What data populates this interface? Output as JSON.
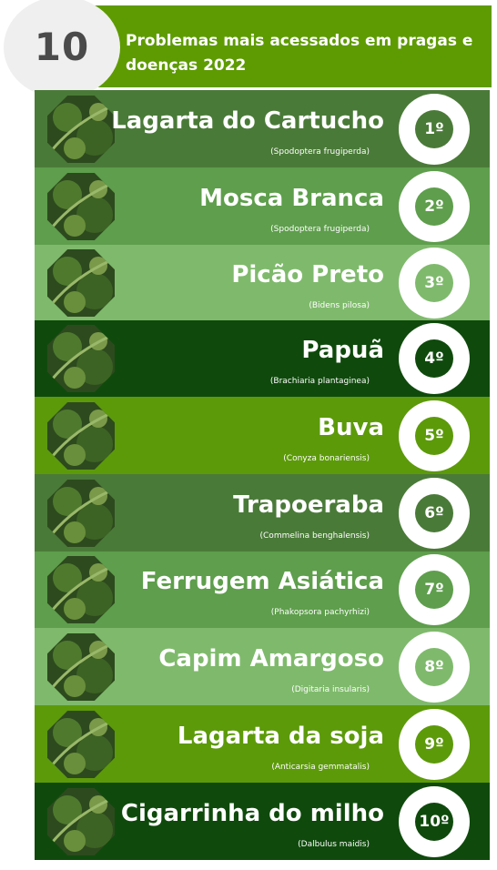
{
  "badge": {
    "number": "10"
  },
  "header": {
    "title": "Problemas mais acessados em pragas e doenças 2022"
  },
  "rows": [
    {
      "rank": "1º",
      "name": "Lagarta do Cartucho",
      "scientific": "(Spodoptera frugiperda)",
      "color": "#4a7a38"
    },
    {
      "rank": "2º",
      "name": "Mosca Branca",
      "scientific": "(Spodoptera frugiperda)",
      "color": "#5e9e4c"
    },
    {
      "rank": "3º",
      "name": "Picão Preto",
      "scientific": "(Bidens pilosa)",
      "color": "#7fba6c"
    },
    {
      "rank": "4º",
      "name": "Papuã",
      "scientific": "(Brachiaria plantaginea)",
      "color": "#0f4a0c"
    },
    {
      "rank": "5º",
      "name": "Buva",
      "scientific": "(Conyza bonariensis)",
      "color": "#5c9a0a"
    },
    {
      "rank": "6º",
      "name": "Trapoeraba",
      "scientific": "(Commelina benghalensis)",
      "color": "#4a7a38"
    },
    {
      "rank": "7º",
      "name": "Ferrugem Asiática",
      "scientific": "(Phakopsora pachyrhizi)",
      "color": "#5e9e4c"
    },
    {
      "rank": "8º",
      "name": "Capim Amargoso",
      "scientific": "(Digitaria insularis)",
      "color": "#7fba6c"
    },
    {
      "rank": "9º",
      "name": "Lagarta da soja",
      "scientific": "(Anticarsia gemmatalis)",
      "color": "#5c9a0a"
    },
    {
      "rank": "10º",
      "name": "Cigarrinha do milho",
      "scientific": "(Dalbulus maidis)",
      "color": "#0f4a0c"
    }
  ]
}
